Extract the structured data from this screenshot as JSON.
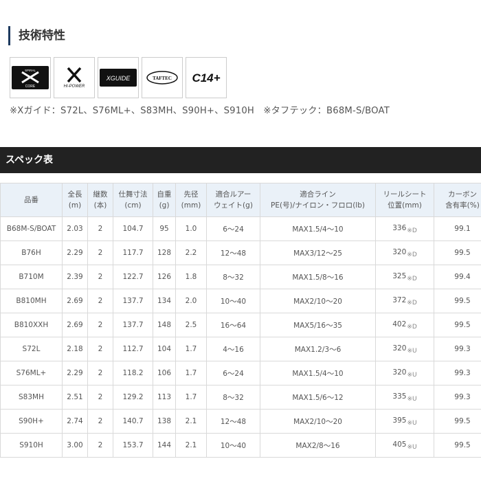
{
  "section": {
    "title": "技術特性"
  },
  "logos": [
    {
      "name": "spiral-x-core",
      "top": "SPIRAL",
      "main": "X",
      "bottom": "CORE",
      "bg": "#111111"
    },
    {
      "name": "x-hi-power",
      "main": "X",
      "bottom": "HI-POWER",
      "bg": "#ffffff"
    },
    {
      "name": "x-guide",
      "main": "XGUIDE",
      "bg": "#111111"
    },
    {
      "name": "taftec",
      "main": "TAFTEC",
      "bg": "#ffffff"
    },
    {
      "name": "c14plus",
      "main": "C14+",
      "bg": "#ffffff"
    }
  ],
  "note": "※Xガイド：S72L、S76ML+、S83MH、S90H+、S910H　※タフテック：B68M-S/BOAT",
  "spec": {
    "title": "スペック表",
    "headers": [
      [
        "品番"
      ],
      [
        "全長",
        "(m)"
      ],
      [
        "継数",
        "(本)"
      ],
      [
        "仕舞寸法",
        "(cm)"
      ],
      [
        "自重",
        "(g)"
      ],
      [
        "先径",
        "(mm)"
      ],
      [
        "適合ルアー",
        "ウェイト(g)"
      ],
      [
        "適合ライン",
        "PE(号)/ナイロン・フロロ(lb)"
      ],
      [
        "リールシート",
        "位置(mm)"
      ],
      [
        "カーボン",
        "含有率(%)"
      ]
    ],
    "rows": [
      {
        "model": "B68M-S/BOAT",
        "length": "2.03",
        "pieces": "2",
        "closed": "104.7",
        "weight": "95",
        "tip": "1.0",
        "lure": "6～24",
        "line": "MAX1.5/4～10",
        "seat": "336",
        "seat_mark": "※D",
        "carbon": "99.1"
      },
      {
        "model": "B76H",
        "length": "2.29",
        "pieces": "2",
        "closed": "117.7",
        "weight": "128",
        "tip": "2.2",
        "lure": "12～48",
        "line": "MAX3/12～25",
        "seat": "320",
        "seat_mark": "※D",
        "carbon": "99.5"
      },
      {
        "model": "B710M",
        "length": "2.39",
        "pieces": "2",
        "closed": "122.7",
        "weight": "126",
        "tip": "1.8",
        "lure": "8～32",
        "line": "MAX1.5/8～16",
        "seat": "325",
        "seat_mark": "※D",
        "carbon": "99.4"
      },
      {
        "model": "B810MH",
        "length": "2.69",
        "pieces": "2",
        "closed": "137.7",
        "weight": "134",
        "tip": "2.0",
        "lure": "10～40",
        "line": "MAX2/10～20",
        "seat": "372",
        "seat_mark": "※D",
        "carbon": "99.5"
      },
      {
        "model": "B810XXH",
        "length": "2.69",
        "pieces": "2",
        "closed": "137.7",
        "weight": "148",
        "tip": "2.5",
        "lure": "16～64",
        "line": "MAX5/16～35",
        "seat": "402",
        "seat_mark": "※D",
        "carbon": "99.5"
      },
      {
        "model": "S72L",
        "length": "2.18",
        "pieces": "2",
        "closed": "112.7",
        "weight": "104",
        "tip": "1.7",
        "lure": "4～16",
        "line": "MAX1.2/3～6",
        "seat": "320",
        "seat_mark": "※U",
        "carbon": "99.3"
      },
      {
        "model": "S76ML+",
        "length": "2.29",
        "pieces": "2",
        "closed": "118.2",
        "weight": "106",
        "tip": "1.7",
        "lure": "6～24",
        "line": "MAX1.5/4～10",
        "seat": "320",
        "seat_mark": "※U",
        "carbon": "99.3"
      },
      {
        "model": "S83MH",
        "length": "2.51",
        "pieces": "2",
        "closed": "129.2",
        "weight": "113",
        "tip": "1.7",
        "lure": "8～32",
        "line": "MAX1.5/6～12",
        "seat": "335",
        "seat_mark": "※U",
        "carbon": "99.3"
      },
      {
        "model": "S90H+",
        "length": "2.74",
        "pieces": "2",
        "closed": "140.7",
        "weight": "138",
        "tip": "2.1",
        "lure": "12～48",
        "line": "MAX2/10～20",
        "seat": "395",
        "seat_mark": "※U",
        "carbon": "99.5"
      },
      {
        "model": "S910H",
        "length": "3.00",
        "pieces": "2",
        "closed": "153.7",
        "weight": "144",
        "tip": "2.1",
        "lure": "10～40",
        "line": "MAX2/8～16",
        "seat": "405",
        "seat_mark": "※U",
        "carbon": "99.5"
      }
    ]
  }
}
